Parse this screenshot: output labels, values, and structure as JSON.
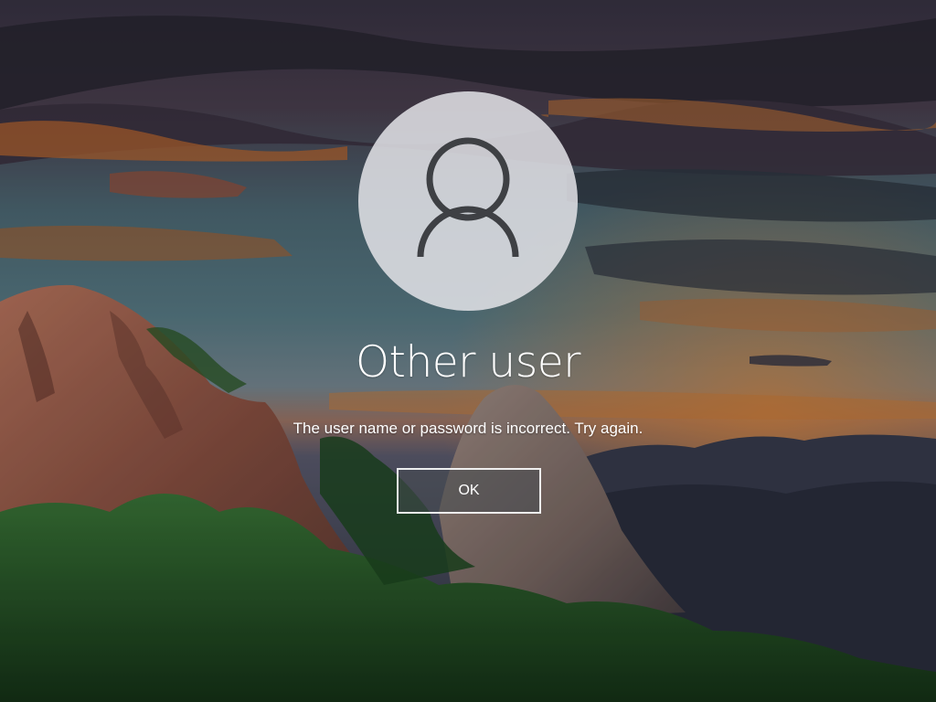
{
  "login": {
    "username": "Other user",
    "error_message": "The user name or password is incorrect. Try again.",
    "ok_label": "OK",
    "avatar_icon": "user-silhouette-icon"
  },
  "colors": {
    "text": "#ffffff",
    "avatar_background": "#e2e2e6",
    "avatar_icon": "#3e4044",
    "button_border": "#ffffff"
  }
}
